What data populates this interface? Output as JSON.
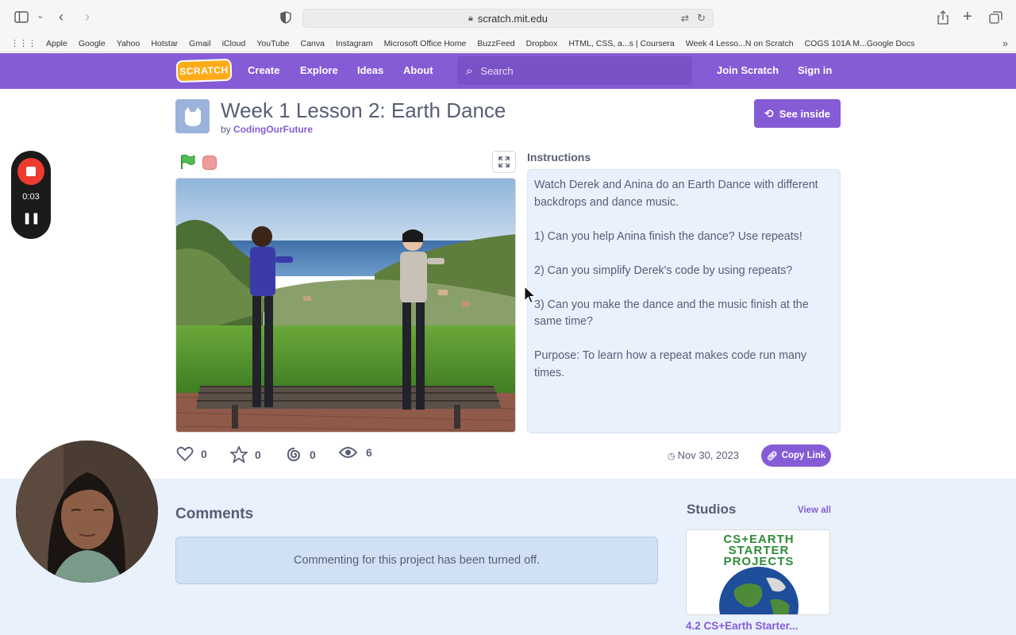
{
  "browser": {
    "url": "scratch.mit.edu",
    "bookmarks": [
      "Apple",
      "Google",
      "Yahoo",
      "Hotstar",
      "Gmail",
      "iCloud",
      "YouTube",
      "Canva",
      "Instagram",
      "Microsoft Office Home",
      "BuzzFeed",
      "Dropbox",
      "HTML, CSS, a...s | Coursera",
      "Week 4 Lesso...N on Scratch",
      "COGS 101A M...Google Docs"
    ]
  },
  "nav": {
    "logo": "SCRATCH",
    "create": "Create",
    "explore": "Explore",
    "ideas": "Ideas",
    "about": "About",
    "search_placeholder": "Search",
    "join": "Join Scratch",
    "signin": "Sign in"
  },
  "project": {
    "title": "Week 1 Lesson 2: Earth Dance",
    "by": "by",
    "author": "CodingOurFuture",
    "see_inside": "See inside",
    "instructions_title": "Instructions",
    "instructions": [
      "Watch Derek and Anina do an Earth Dance with different backdrops and dance music.",
      "1) Can you help Anina finish the dance? Use repeats!",
      "2) Can you simplify Derek's code by using repeats?",
      "3) Can you make the dance and the music finish at the same time?",
      "Purpose: To learn how a repeat makes code run many times."
    ],
    "loves": "0",
    "favorites": "0",
    "remixes": "0",
    "views": "6",
    "date": "Nov 30, 2023",
    "copy_link": "Copy Link"
  },
  "recorder": {
    "time": "0:03"
  },
  "comments": {
    "title": "Comments",
    "notice": "Commenting for this project has been turned off."
  },
  "studios": {
    "title": "Studios",
    "view_all": "View all",
    "thumb_text": [
      "CS+EARTH",
      "STARTER",
      "PROJECTS"
    ],
    "name": "4.2 CS+Earth Starter..."
  },
  "colors": {
    "brand": "#855cd6",
    "logo": "#ffab19",
    "panel": "#e9f1fc"
  }
}
